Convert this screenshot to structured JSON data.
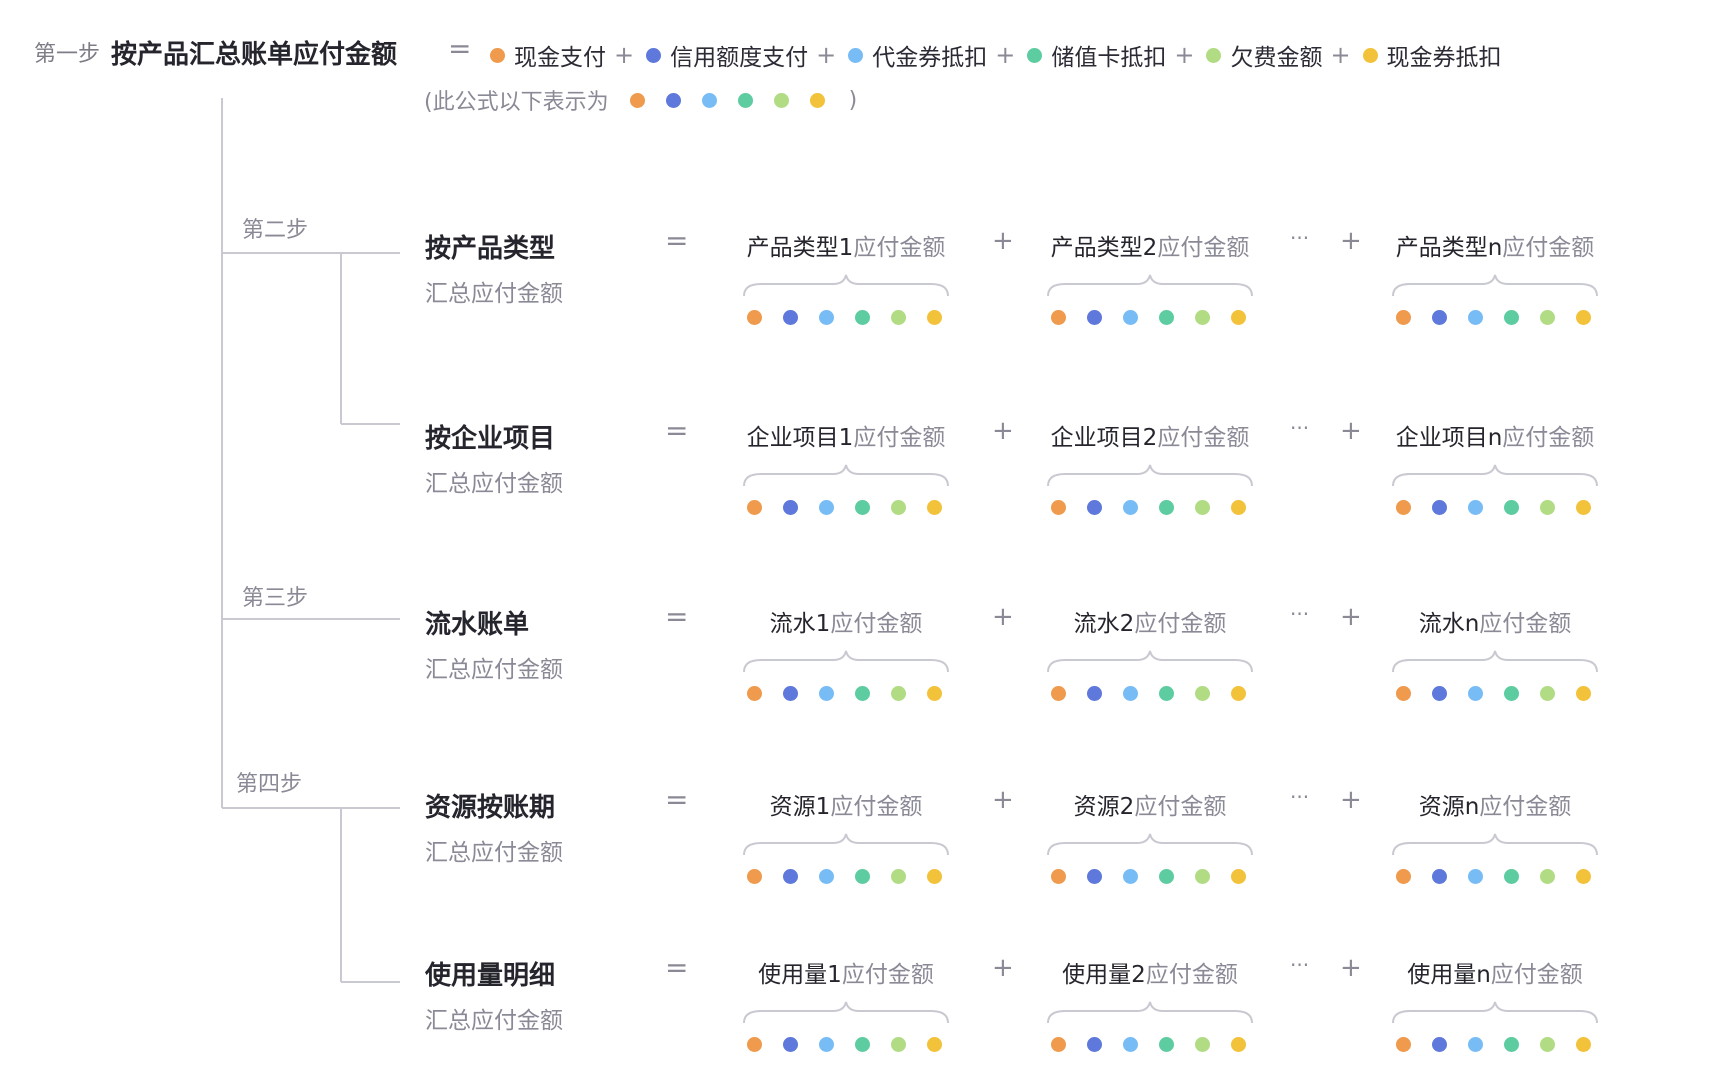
{
  "colors": {
    "cash": "#ef9a4d",
    "credit": "#5f78dc",
    "voucher": "#78bcf6",
    "stored_card": "#5dcca0",
    "arrears": "#b1dc84",
    "cash_coupon": "#f3c23b",
    "line": "#c9c9d1"
  },
  "header": {
    "step": "第一步",
    "title": "按产品汇总账单应付金额",
    "equals": "=",
    "plus": "+",
    "legend": [
      {
        "label": "现金支付",
        "color_key": "cash",
        "icon": "orange-dot"
      },
      {
        "label": "信用额度支付",
        "color_key": "credit",
        "icon": "blue-dot"
      },
      {
        "label": "代金券抵扣",
        "color_key": "voucher",
        "icon": "light-blue-dot"
      },
      {
        "label": "储值卡抵扣",
        "color_key": "stored_card",
        "icon": "green-dot"
      },
      {
        "label": "欠费金额",
        "color_key": "arrears",
        "icon": "light-green-dot"
      },
      {
        "label": "现金券抵扣",
        "color_key": "cash_coupon",
        "icon": "yellow-dot"
      }
    ],
    "note_open": "(此公式以下表示为",
    "note_close": ")"
  },
  "steps": {
    "step2": "第二步",
    "step3": "第三步",
    "step4": "第四步"
  },
  "ops": {
    "equals": "=",
    "plus": "+",
    "ellipsis": "···"
  },
  "rows": [
    {
      "title": "按产品类型",
      "subtitle": "汇总应付金额",
      "terms": [
        {
          "dark": "产品类型1",
          "light": "应付金额"
        },
        {
          "dark": "产品类型2",
          "light": "应付金额"
        },
        {
          "dark": "产品类型n",
          "light": "应付金额"
        }
      ]
    },
    {
      "title": "按企业项目",
      "subtitle": "汇总应付金额",
      "terms": [
        {
          "dark": "企业项目1",
          "light": "应付金额"
        },
        {
          "dark": "企业项目2",
          "light": "应付金额"
        },
        {
          "dark": "企业项目n",
          "light": "应付金额"
        }
      ]
    },
    {
      "title": "流水账单",
      "subtitle": "汇总应付金额",
      "terms": [
        {
          "dark": "流水1",
          "light": "应付金额"
        },
        {
          "dark": "流水2",
          "light": "应付金额"
        },
        {
          "dark": "流水n",
          "light": "应付金额"
        }
      ]
    },
    {
      "title": "资源按账期",
      "subtitle": "汇总应付金额",
      "terms": [
        {
          "dark": "资源1",
          "light": "应付金额"
        },
        {
          "dark": "资源2",
          "light": "应付金额"
        },
        {
          "dark": "资源n",
          "light": "应付金额"
        }
      ]
    },
    {
      "title": "使用量明细",
      "subtitle": "汇总应付金额",
      "terms": [
        {
          "dark": "使用量1",
          "light": "应付金额"
        },
        {
          "dark": "使用量2",
          "light": "应付金额"
        },
        {
          "dark": "使用量n",
          "light": "应付金额"
        }
      ]
    }
  ]
}
